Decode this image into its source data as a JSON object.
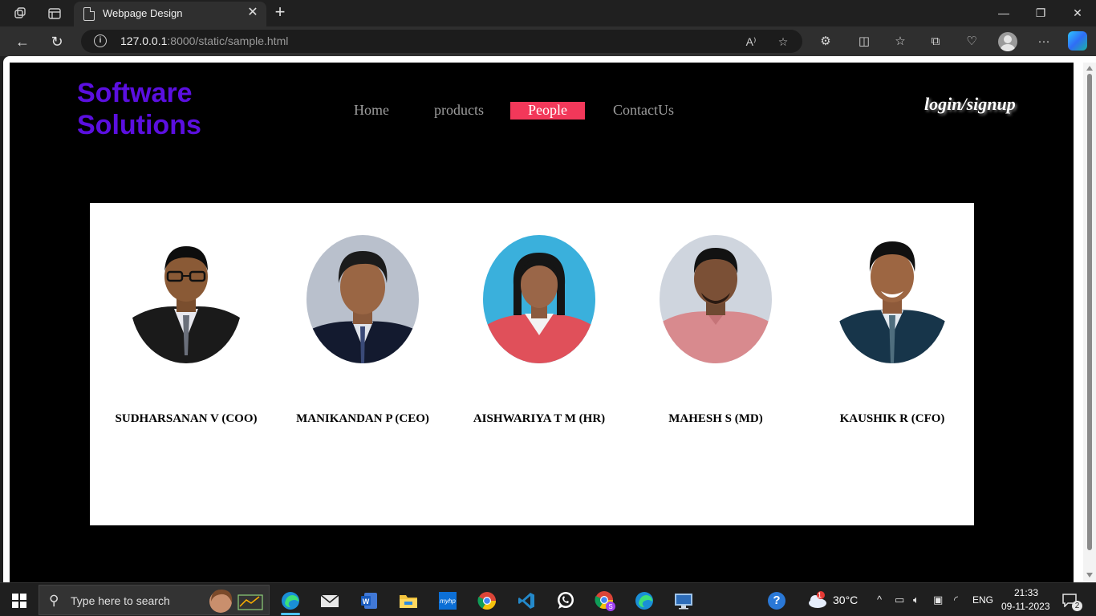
{
  "browser": {
    "tab_title": "Webpage Design",
    "url_host": "127.0.0.1",
    "url_rest": ":8000/static/sample.html"
  },
  "site": {
    "brand_line1": "Software",
    "brand_line2": "Solutions",
    "nav": [
      "Home",
      "products",
      "People",
      "ContactUs"
    ],
    "active_nav": "People",
    "login": "login/signup",
    "colors": {
      "brand": "#5b0fe0",
      "active_nav_bg": "#f2385a",
      "page_bg": "#000000"
    }
  },
  "people": [
    {
      "name": "SUDHARSANAN V (COO)"
    },
    {
      "name": "MANIKANDAN P (CEO)"
    },
    {
      "name": "AISHWARIYA T M (HR)"
    },
    {
      "name": "MAHESH S (MD)"
    },
    {
      "name": "KAUSHIK R (CFO)"
    }
  ],
  "taskbar": {
    "search_placeholder": "Type here to search",
    "weather": "30°C",
    "language": "ENG",
    "time": "21:33",
    "date": "09-11-2023",
    "notification_count": "2",
    "weather_badge": "1",
    "apps": [
      "edge-icon",
      "mail-icon",
      "word-icon",
      "file-explorer-icon",
      "myhp-icon",
      "chrome-icon",
      "vscode-icon",
      "whatsapp-icon",
      "chrome-profile-icon",
      "edge-icon-2",
      "remote-desktop-icon"
    ]
  }
}
